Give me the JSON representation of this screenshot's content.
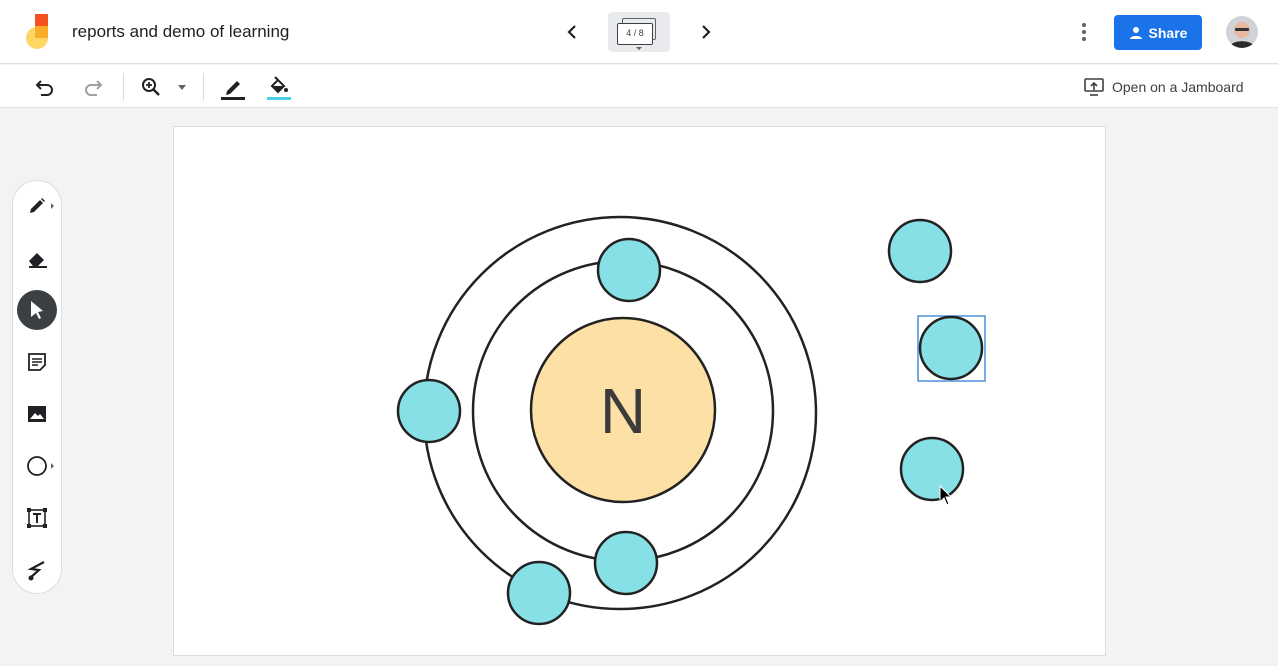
{
  "header": {
    "title": "reports and demo of learning",
    "frame_indicator": "4 / 8",
    "share_label": "Share"
  },
  "toolbar": {
    "open_jamboard_label": "Open on a Jamboard"
  },
  "canvas": {
    "nucleus_label": "N",
    "colors": {
      "nucleus_fill": "#fde0a5",
      "electron_fill": "#86e0e6",
      "stroke": "#222222",
      "selection": "#4a90d9"
    }
  },
  "colors": {
    "accent": "#1a73e8",
    "fill_indicator": "#4ecde6"
  }
}
